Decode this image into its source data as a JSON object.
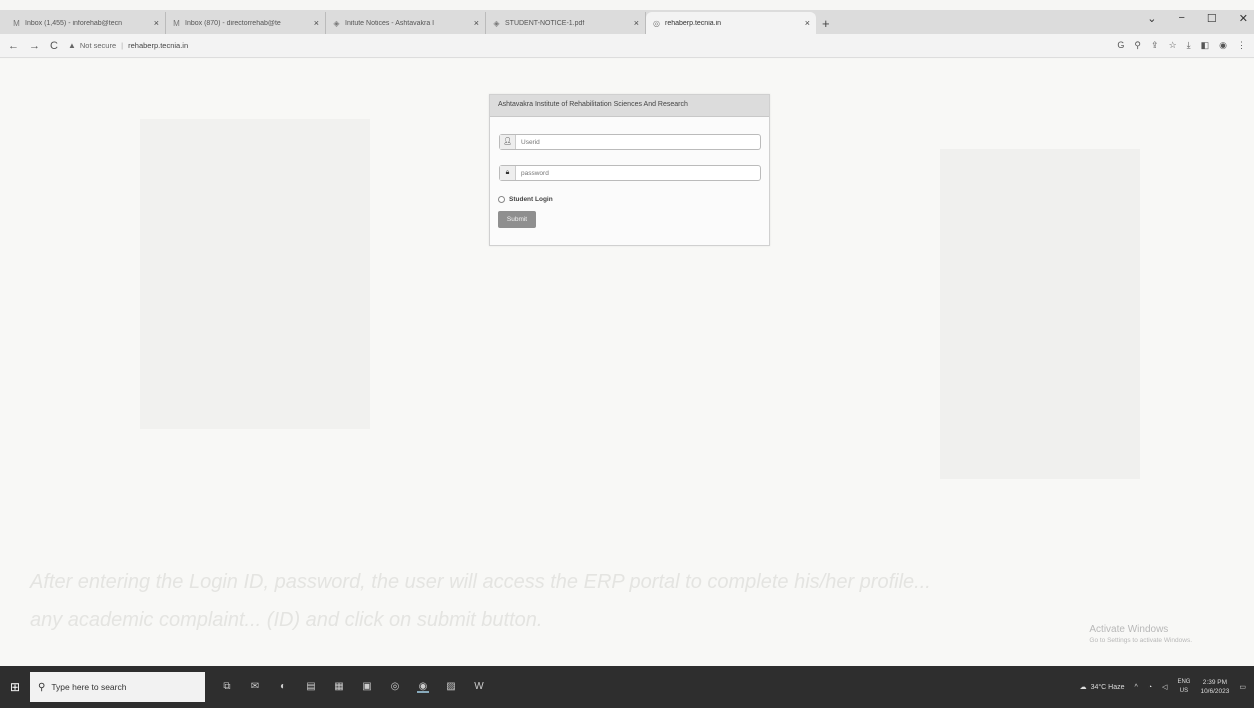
{
  "browser": {
    "tabs": [
      {
        "favicon": "M",
        "title": "Inbox (1,455) - inforehab@tecn"
      },
      {
        "favicon": "M",
        "title": "Inbox (870) - directorrehab@te"
      },
      {
        "favicon": "◈",
        "title": "Initute Notices - Ashtavakra I"
      },
      {
        "favicon": "◈",
        "title": "STUDENT-NOTICE-1.pdf"
      },
      {
        "favicon": "◎",
        "title": "rehaberp.tecnia.in"
      }
    ],
    "active_tab_index": 4,
    "new_tab": "+",
    "security_label": "Not secure",
    "url": "rehaberp.tecnia.in"
  },
  "login": {
    "title": "Ashtavakra Institute of Rehabilitation Sciences And Research",
    "username_placeholder": "Userid",
    "password_placeholder": "password",
    "student_login_label": "Student Login",
    "submit_label": "Submit"
  },
  "background": {
    "line1": "After entering the Login ID, password, the user will access the ERP portal to complete his/her profile...",
    "line2": "any academic complaint... (ID) and click on submit button."
  },
  "watermark": {
    "line1": "Activate Windows",
    "line2": "Go to Settings to activate Windows."
  },
  "taskbar": {
    "search_placeholder": "Type here to search",
    "weather": "34°C Haze",
    "lang_line1": "ENG",
    "lang_line2": "US",
    "time": "2:39 PM",
    "date": "10/6/2023"
  }
}
